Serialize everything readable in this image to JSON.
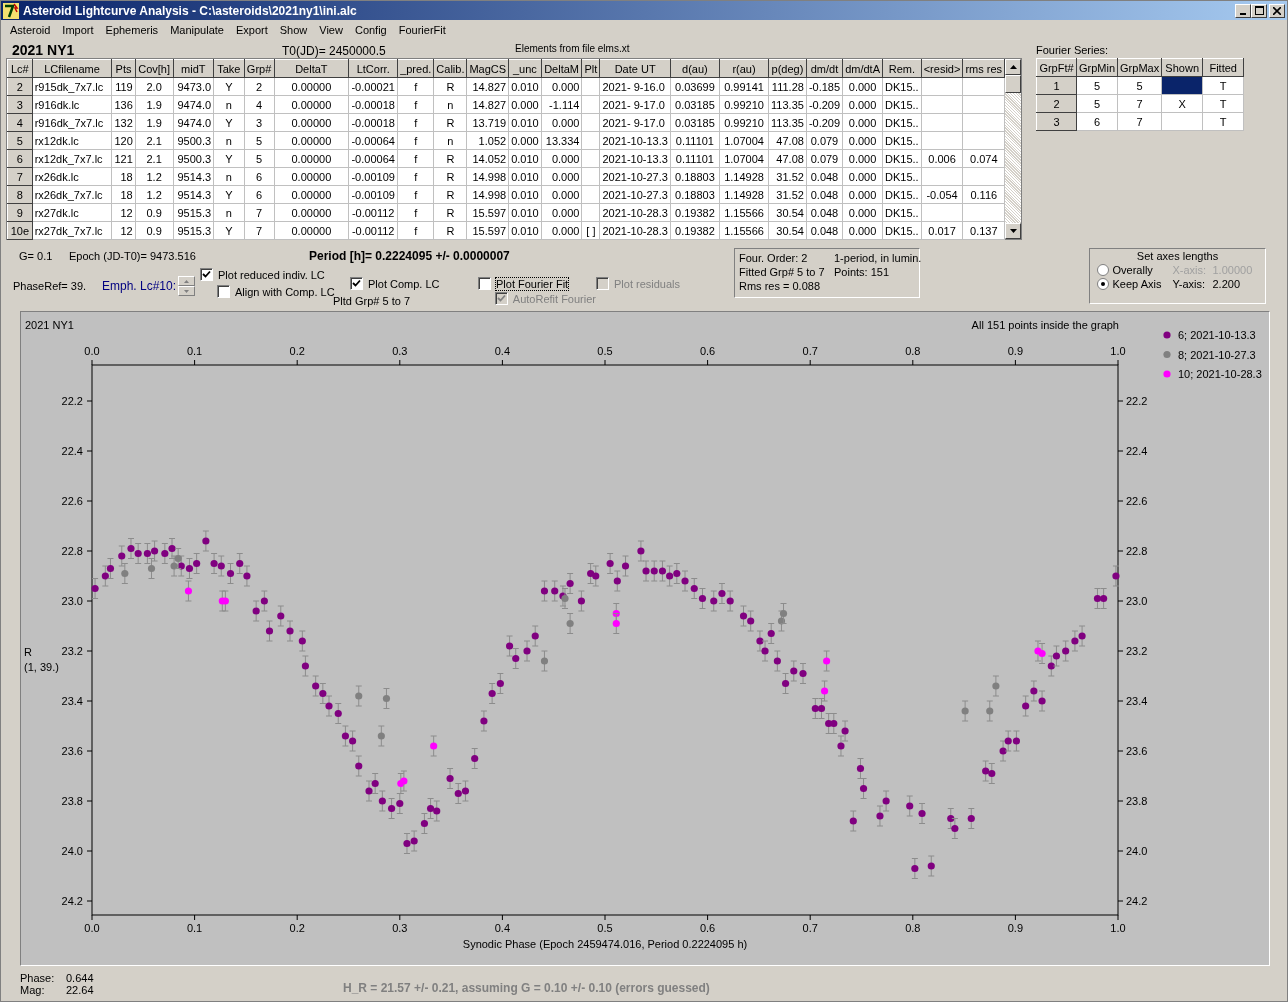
{
  "window": {
    "title": "Asteroid Lightcurve Analysis - C:\\asteroids\\2021ny1\\ini.alc"
  },
  "menu": [
    "Asteroid",
    "Import",
    "Ephemeris",
    "Manipulate",
    "Export",
    "Show",
    "View",
    "Config",
    "FourierFit"
  ],
  "header": {
    "object": "2021 NY1",
    "t0": "T0(JD)= 2450000.5",
    "elements": "Elements from file elms.xt"
  },
  "table": {
    "columns": [
      "Lc#",
      "LCfilename",
      "Pts",
      "Cov[h]",
      "midT",
      "Take",
      "Grp#",
      "DeltaT",
      "LtCorr.",
      "_pred.",
      "Calib.",
      "MagCS",
      "_unc",
      "DeltaM",
      "Plt",
      "Date UT",
      "d(au)",
      "r(au)",
      "p(deg)",
      "dm/dt",
      "dm/dtA",
      "Rem.",
      "<resid>",
      "rms res"
    ],
    "rows": [
      [
        "2",
        "r915dk_7x7.lc",
        "119",
        "2.0",
        "9473.0",
        "Y",
        "2",
        "0.00000",
        "-0.00021",
        "f",
        "R",
        "14.827",
        "0.010",
        "0.000",
        null,
        "2021- 9-16.0",
        "0.03699",
        "0.99141",
        "111.28",
        "-0.185",
        "0.000",
        "DK15..",
        null,
        null
      ],
      [
        "3",
        "r916dk.lc",
        "136",
        "1.9",
        "9474.0",
        "n",
        "4",
        "0.00000",
        "-0.00018",
        "f",
        "n",
        "14.827",
        "0.000",
        "-1.114",
        null,
        "2021- 9-17.0",
        "0.03185",
        "0.99210",
        "113.35",
        "-0.209",
        "0.000",
        "DK15..",
        null,
        null
      ],
      [
        "4",
        "r916dk_7x7.lc",
        "132",
        "1.9",
        "9474.0",
        "Y",
        "3",
        "0.00000",
        "-0.00018",
        "f",
        "R",
        "13.719",
        "0.010",
        "0.000",
        null,
        "2021- 9-17.0",
        "0.03185",
        "0.99210",
        "113.35",
        "-0.209",
        "0.000",
        "DK15..",
        null,
        null
      ],
      [
        "5",
        "rx12dk.lc",
        "120",
        "2.1",
        "9500.3",
        "n",
        "5",
        "0.00000",
        "-0.00064",
        "f",
        "n",
        "1.052",
        "0.000",
        "13.334",
        null,
        "2021-10-13.3",
        "0.11101",
        "1.07004",
        "47.08",
        "0.079",
        "0.000",
        "DK15..",
        null,
        null
      ],
      [
        "6",
        "rx12dk_7x7.lc",
        "121",
        "2.1",
        "9500.3",
        "Y",
        "5",
        "0.00000",
        "-0.00064",
        "f",
        "R",
        "14.052",
        "0.010",
        "0.000",
        null,
        "2021-10-13.3",
        "0.11101",
        "1.07004",
        "47.08",
        "0.079",
        "0.000",
        "DK15..",
        "0.006",
        "0.074"
      ],
      [
        "7",
        "rx26dk.lc",
        "18",
        "1.2",
        "9514.3",
        "n",
        "6",
        "0.00000",
        "-0.00109",
        "f",
        "R",
        "14.998",
        "0.010",
        "0.000",
        null,
        "2021-10-27.3",
        "0.18803",
        "1.14928",
        "31.52",
        "0.048",
        "0.000",
        "DK15..",
        null,
        null
      ],
      [
        "8",
        "rx26dk_7x7.lc",
        "18",
        "1.2",
        "9514.3",
        "Y",
        "6",
        "0.00000",
        "-0.00109",
        "f",
        "R",
        "14.998",
        "0.010",
        "0.000",
        null,
        "2021-10-27.3",
        "0.18803",
        "1.14928",
        "31.52",
        "0.048",
        "0.000",
        "DK15..",
        "-0.054",
        "0.116"
      ],
      [
        "9",
        "rx27dk.lc",
        "12",
        "0.9",
        "9515.3",
        "n",
        "7",
        "0.00000",
        "-0.00112",
        "f",
        "R",
        "15.597",
        "0.010",
        "0.000",
        null,
        "2021-10-28.3",
        "0.19382",
        "1.15566",
        "30.54",
        "0.048",
        "0.000",
        "DK15..",
        null,
        null
      ],
      [
        "10e",
        "rx27dk_7x7.lc",
        "12",
        "0.9",
        "9515.3",
        "Y",
        "7",
        "0.00000",
        "-0.00112",
        "f",
        "R",
        "15.597",
        "0.010",
        "0.000",
        "[ ]",
        "2021-10-28.3",
        "0.19382",
        "1.15566",
        "30.54",
        "0.048",
        "0.000",
        "DK15..",
        "0.017",
        "0.137"
      ]
    ]
  },
  "fourier": {
    "label": "Fourier Series:",
    "columns": [
      "GrpFt#",
      "GrpMin",
      "GrpMax",
      "Shown",
      "Fitted"
    ],
    "rows": [
      {
        "cells": [
          "1",
          "5",
          "5",
          null,
          "T"
        ],
        "selected": true
      },
      {
        "cells": [
          "2",
          "5",
          "7",
          "X",
          "T"
        ],
        "selected": false
      },
      {
        "cells": [
          "3",
          "6",
          "7",
          null,
          "T"
        ],
        "selected": false
      }
    ]
  },
  "controls": {
    "g": "G= 0.1",
    "epoch": "Epoch (JD-T0)= 9473.516",
    "period": "Period [h]= 0.2224095 +/- 0.0000007",
    "phase_ref": "PhaseRef= 39.",
    "emph": "Emph. Lc#10:",
    "pltd_grp": "Pltd Grp#  5  to  7",
    "checkboxes": [
      {
        "label": "Plot reduced indiv. LC",
        "checked": true,
        "disabled": false
      },
      {
        "label": "Align with Comp. LC",
        "checked": false,
        "disabled": false
      },
      {
        "label": "Plot Comp. LC",
        "checked": true,
        "disabled": false
      },
      {
        "label": "Plot Fourier Fit",
        "checked": false,
        "disabled": false
      },
      {
        "label": "AutoRefit Fourier",
        "checked": true,
        "disabled": true
      },
      {
        "label": "Plot residuals",
        "checked": false,
        "disabled": true
      }
    ]
  },
  "fit_info": [
    "Four. Order:  2",
    "1-period, in lumin.",
    "Fitted Grp# 5 to 7",
    "Points: 151",
    "Rms res     = 0.088"
  ],
  "axes_box": {
    "title": "Set axes lengths",
    "radios": [
      {
        "label": "Overally",
        "selected": false
      },
      {
        "label": "Keep Axis",
        "selected": true
      }
    ],
    "x_label": "X-axis:",
    "x_value": "1.00000",
    "x_disabled": true,
    "y_label": "Y-axis:",
    "y_value": "2.200"
  },
  "plot": {
    "chart_data": {
      "type": "scatter",
      "title": "2021 NY1",
      "xlabel": "Synodic Phase (Epoch 2459474.016, Period 0.2224095 h)",
      "ylabel": "R",
      "xlim": [
        0,
        1
      ],
      "ylim": [
        24.256,
        22.056
      ],
      "xticks": [
        {
          "value": 0,
          "label": "0.0"
        },
        {
          "value": 0.1,
          "label": "0.1"
        },
        {
          "value": 0.2,
          "label": "0.2"
        },
        {
          "value": 0.3,
          "label": "0.3"
        },
        {
          "value": 0.4,
          "label": "0.4"
        },
        {
          "value": 0.5,
          "label": "0.5"
        },
        {
          "value": 0.6,
          "label": "0.6"
        },
        {
          "value": 0.7,
          "label": "0.7"
        },
        {
          "value": 0.8,
          "label": "0.8"
        },
        {
          "value": 0.9,
          "label": "0.9"
        },
        {
          "value": 1,
          "label": "1.0"
        }
      ],
      "yticks": [
        {
          "value": 22.2,
          "label": "22.2"
        },
        {
          "value": 22.4,
          "label": "22.4"
        },
        {
          "value": 22.6,
          "label": "22.6"
        },
        {
          "value": 22.8,
          "label": "22.8"
        },
        {
          "value": 23,
          "label": "23.0"
        },
        {
          "value": 23.2,
          "label": "23.2"
        },
        {
          "value": 23.4,
          "label": "23.4"
        },
        {
          "value": 23.6,
          "label": "23.6"
        },
        {
          "value": 23.8,
          "label": "23.8"
        },
        {
          "value": 24,
          "label": "24.0"
        },
        {
          "value": 24.2,
          "label": "24.2"
        }
      ],
      "annotations": [
        "All 151 points inside the graph",
        "(1, 39.)"
      ],
      "legend": true,
      "series": [
        {
          "name": "6; 2021-10-13.3",
          "color": "#800080",
          "x": [
            0.003,
            0.013,
            0.018,
            0.029,
            0.038,
            0.045,
            0.054,
            0.061,
            0.071,
            0.078,
            0.087,
            0.095,
            0.102,
            0.111,
            0.119,
            0.126,
            0.135,
            0.144,
            0.151,
            0.16,
            0.168,
            0.173,
            0.184,
            0.193,
            0.205,
            0.208,
            0.218,
            0.225,
            0.231,
            0.24,
            0.247,
            0.254,
            0.26,
            0.27,
            0.276,
            0.283,
            0.292,
            0.3,
            0.307,
            0.314,
            0.324,
            0.33,
            0.336,
            0.349,
            0.357,
            0.364,
            0.373,
            0.382,
            0.39,
            0.398,
            0.407,
            0.413,
            0.424,
            0.432,
            0.441,
            0.451,
            0.459,
            0.466,
            0.477,
            0.486,
            0.491,
            0.505,
            0.512,
            0.52,
            0.535,
            0.54,
            0.548,
            0.556,
            0.563,
            0.57,
            0.578,
            0.587,
            0.595,
            0.606,
            0.614,
            0.622,
            0.635,
            0.642,
            0.651,
            0.656,
            0.662,
            0.668,
            0.676,
            0.684,
            0.693,
            0.705,
            0.711,
            0.718,
            0.723,
            0.73,
            0.734,
            0.742,
            0.749,
            0.752,
            0.768,
            0.774,
            0.797,
            0.802,
            0.809,
            0.818,
            0.837,
            0.841,
            0.857,
            0.871,
            0.877,
            0.888,
            0.893,
            0.901,
            0.91,
            0.918,
            0.926,
            0.935,
            0.94,
            0.949,
            0.958,
            0.965,
            0.98,
            0.986,
            0.998
          ],
          "values": [
            22.95,
            22.9,
            22.87,
            22.82,
            22.79,
            22.81,
            22.81,
            22.8,
            22.81,
            22.79,
            22.86,
            22.87,
            22.85,
            22.76,
            22.85,
            22.86,
            22.89,
            22.85,
            22.9,
            23.04,
            23,
            23.12,
            23.06,
            23.12,
            23.16,
            23.26,
            23.34,
            23.37,
            23.42,
            23.45,
            23.54,
            23.56,
            23.66,
            23.76,
            23.73,
            23.8,
            23.83,
            23.81,
            23.97,
            23.96,
            23.89,
            23.83,
            23.84,
            23.71,
            23.77,
            23.76,
            23.63,
            23.48,
            23.37,
            23.33,
            23.18,
            23.23,
            23.2,
            23.14,
            22.96,
            22.96,
            22.98,
            22.93,
            23,
            22.89,
            22.9,
            22.85,
            22.92,
            22.86,
            22.8,
            22.88,
            22.88,
            22.88,
            22.9,
            22.89,
            22.92,
            22.95,
            22.99,
            23,
            22.97,
            23,
            23.06,
            23.08,
            23.16,
            23.2,
            23.13,
            23.24,
            23.33,
            23.28,
            23.29,
            23.43,
            23.43,
            23.49,
            23.49,
            23.58,
            23.52,
            23.88,
            23.67,
            23.75,
            23.86,
            23.8,
            23.82,
            24.07,
            23.85,
            24.06,
            23.87,
            23.91,
            23.87,
            23.68,
            23.69,
            23.6,
            23.56,
            23.56,
            23.42,
            23.36,
            23.4,
            23.26,
            23.22,
            23.2,
            23.16,
            23.14,
            22.99,
            22.99,
            22.9
          ]
        },
        {
          "name": "8; 2021-10-27.3",
          "color": "#808080",
          "x": [
            0.032,
            0.058,
            0.08,
            0.084,
            0.26,
            0.282,
            0.287,
            0.441,
            0.461,
            0.466,
            0.672,
            0.674,
            0.851,
            0.875,
            0.881
          ],
          "values": [
            22.89,
            22.87,
            22.86,
            22.83,
            23.38,
            23.54,
            23.39,
            23.24,
            22.99,
            23.09,
            23.08,
            23.05,
            23.44,
            23.44,
            23.34
          ]
        },
        {
          "name": "10; 2021-10-28.3",
          "color": "#ff00ff",
          "x": [
            0.094,
            0.127,
            0.13,
            0.301,
            0.304,
            0.333,
            0.511,
            0.511,
            0.714,
            0.716,
            0.922,
            0.926
          ],
          "values": [
            22.96,
            23,
            23,
            23.73,
            23.72,
            23.58,
            23.05,
            23.09,
            23.36,
            23.24,
            23.2,
            23.21
          ]
        }
      ]
    }
  },
  "status": {
    "phase_label": "Phase:",
    "phase": "0.644",
    "mag_label": "Mag:",
    "mag": "22.64",
    "hr": "H_R = 21.57 +/- 0.21, assuming G = 0.10 +/- 0.10 (errors guessed)"
  }
}
